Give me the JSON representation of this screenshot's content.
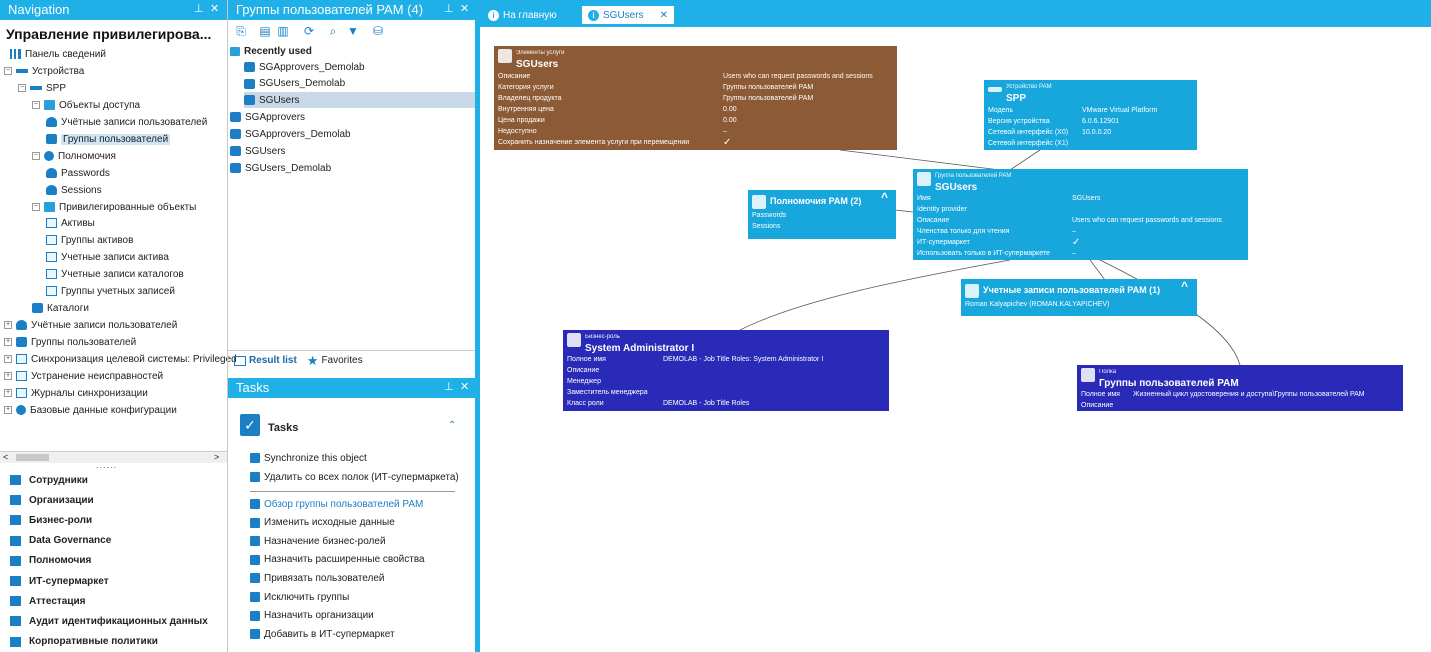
{
  "nav": {
    "title": "Navigation",
    "root_label": "Управление привилегирова...",
    "tree": [
      {
        "label": "Панель сведений",
        "icon": "chart-icon"
      },
      {
        "label": "Устройства",
        "icon": "device-icon"
      },
      {
        "label": "SPP",
        "icon": "device-icon"
      },
      {
        "label": "Объекты доступа",
        "icon": "folder-icon"
      },
      {
        "label": "Учётные записи пользователей",
        "icon": "person-icon"
      },
      {
        "label": "Группы пользователей",
        "icon": "group-icon"
      },
      {
        "label": "Полномочия",
        "icon": "key-icon"
      },
      {
        "label": "Passwords",
        "icon": "person-icon"
      },
      {
        "label": "Sessions",
        "icon": "person-icon"
      },
      {
        "label": "Привилегированные объекты",
        "icon": "folder-icon"
      },
      {
        "label": "Активы",
        "icon": "monitor-icon"
      },
      {
        "label": "Группы активов",
        "icon": "monitor-icon"
      },
      {
        "label": "Учетные записи актива",
        "icon": "monitor-icon"
      },
      {
        "label": "Учетные записи каталогов",
        "icon": "monitor-icon"
      },
      {
        "label": "Группы учетных записей",
        "icon": "monitor-icon"
      },
      {
        "label": "Каталоги",
        "icon": "group-icon"
      },
      {
        "label": "Учётные записи пользователей",
        "icon": "person-icon"
      },
      {
        "label": "Группы пользователей",
        "icon": "group-icon"
      },
      {
        "label": "Синхронизация целевой системы: Privileged",
        "icon": "monitor-icon"
      },
      {
        "label": "Устранение неисправностей",
        "icon": "monitor-icon"
      },
      {
        "label": "Журналы синхронизации",
        "icon": "monitor-icon"
      },
      {
        "label": "Базовые данные конфигурации",
        "icon": "key-icon"
      }
    ],
    "categories": [
      "Сотрудники",
      "Организации",
      "Бизнес-роли",
      "Data Governance",
      "Полномочия",
      "ИТ-супермаркет",
      "Аттестация",
      "Аудит идентификационных данных",
      "Корпоративные политики"
    ],
    "scroll_left": "<",
    "scroll_right": ">",
    "splitter": "......"
  },
  "list": {
    "title": "Группы пользователей PAM (4)",
    "recent_label": "Recently used",
    "recent": [
      "SGApprovers_Demolab",
      "SGUsers_Demolab",
      "SGUsers"
    ],
    "items": [
      "SGApprovers",
      "SGApprovers_Demolab",
      "SGUsers",
      "SGUsers_Demolab"
    ],
    "tab_results": "Result list",
    "tab_favorites": "Favorites"
  },
  "tasks": {
    "title": "Tasks",
    "section": "Tasks",
    "group1": [
      "Synchronize this object",
      "Удалить со всех полок (ИТ-супермаркета)"
    ],
    "group2": [
      "Обзор группы пользователей PAM",
      "Изменить исходные данные",
      "Назначение бизнес-ролей",
      "Назначить расширенные свойства",
      "Привязать пользователей",
      "Исключить группы",
      "Назначить организации",
      "Добавить в ИТ-супермаркет"
    ]
  },
  "tabs": {
    "home": "На главную",
    "current": "SGUsers",
    "close": "✕"
  },
  "colors": {
    "accent": "#1eb0e6",
    "brown": "#8c5a35",
    "navy": "#2a2ab8",
    "link": "#1a7fc4"
  },
  "cards": {
    "service": {
      "type": "Элементы услуги",
      "name": "SGUsers",
      "rows": [
        [
          "Описание",
          "Users who can request passwords and sessions"
        ],
        [
          "Категория услуги",
          "Группы пользователей PAM"
        ],
        [
          "Владелец продукта",
          "Группы пользователей PAM"
        ],
        [
          "Внутренняя цена",
          "0.00"
        ],
        [
          "Цена продажи",
          "0.00"
        ],
        [
          "Недоступно",
          "–"
        ],
        [
          "Сохранить назначение элемента услуги при перемещении",
          "✓"
        ]
      ]
    },
    "device": {
      "type": "Устройство PAM",
      "name": "SPP",
      "rows": [
        [
          "Модель",
          "VMware Virtual Platform"
        ],
        [
          "Версия устройства",
          "6.0.6.12901"
        ],
        [
          "Сетевой интерфейс (X0)",
          "10.0.0.20"
        ],
        [
          "Сетевой интерфейс (X1)",
          ""
        ]
      ]
    },
    "entitlements": {
      "name": "Полномочия PAM (2)",
      "rows": [
        "Passwords",
        "Sessions"
      ]
    },
    "group": {
      "type": "Группа пользователей PAM",
      "name": "SGUsers",
      "rows": [
        [
          "Имя",
          "SGUsers"
        ],
        [
          "Identity provider",
          ""
        ],
        [
          "Описание",
          "Users who can request passwords and sessions"
        ],
        [
          "Членства только для чтения",
          "–"
        ],
        [
          "ИТ-супермаркет",
          "✓"
        ],
        [
          "Использовать только в ИТ-супермаркете",
          "–"
        ]
      ]
    },
    "accounts": {
      "name": "Учетные записи пользователей PAM (1)",
      "rows": [
        "Roman Kalyapichev (ROMAN.KALYAPICHEV)"
      ]
    },
    "role": {
      "type": "Бизнес-роль",
      "name": "System Administrator I",
      "rows": [
        [
          "Полное имя",
          "DEMOLAB - Job Title Roles: System Administrator I"
        ],
        [
          "Описание",
          ""
        ],
        [
          "Менеджер",
          ""
        ],
        [
          "Заместитель менеджера",
          ""
        ],
        [
          "Класс роли",
          "DEMOLAB - Job Title Roles"
        ]
      ]
    },
    "shelf": {
      "type": "Полка",
      "name": "Группы пользователей PAM",
      "rows": [
        [
          "Полное имя",
          "Жизненный цикл удостоверения и доступа\\Группы пользователей PAM"
        ],
        [
          "Описание",
          ""
        ]
      ]
    }
  }
}
